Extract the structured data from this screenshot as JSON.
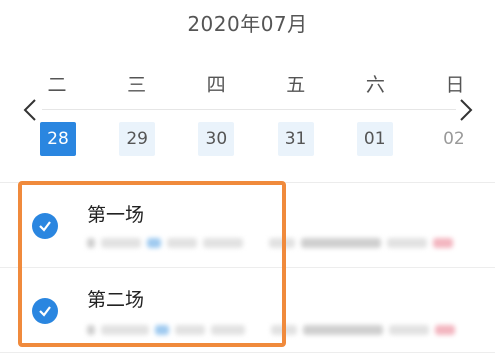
{
  "calendar": {
    "month_title": "2020年07月",
    "weekdays": [
      "二",
      "三",
      "四",
      "五",
      "六",
      "日"
    ],
    "dates": [
      {
        "label": "28",
        "state": "selected"
      },
      {
        "label": "29",
        "state": "available"
      },
      {
        "label": "30",
        "state": "available"
      },
      {
        "label": "31",
        "state": "available"
      },
      {
        "label": "01",
        "state": "available"
      },
      {
        "label": "02",
        "state": "plain"
      }
    ],
    "prev_icon": "chevron-left-icon",
    "next_icon": "chevron-right-icon"
  },
  "sessions": [
    {
      "name": "第一场",
      "checked": true
    },
    {
      "name": "第二场",
      "checked": true
    }
  ],
  "colors": {
    "accent": "#2a86e0",
    "highlight_border": "#f08a3c"
  }
}
